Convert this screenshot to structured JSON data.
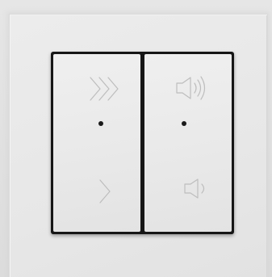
{
  "scene": {
    "object": "wall-switch",
    "colors": {
      "wall": "#e1e1e1",
      "frame": "#e8e8e8",
      "rocker": "#ececec",
      "gap": "#161616",
      "symbol_stroke": "#bdbdbd",
      "led": "#1a1a1a"
    }
  },
  "left_rocker": {
    "top_icon": "fast-forward-icon",
    "bottom_icon": "chevron-right-icon",
    "indicator": "led-dot"
  },
  "right_rocker": {
    "top_icon": "volume-up-icon",
    "bottom_icon": "volume-down-icon",
    "indicator": "led-dot"
  }
}
